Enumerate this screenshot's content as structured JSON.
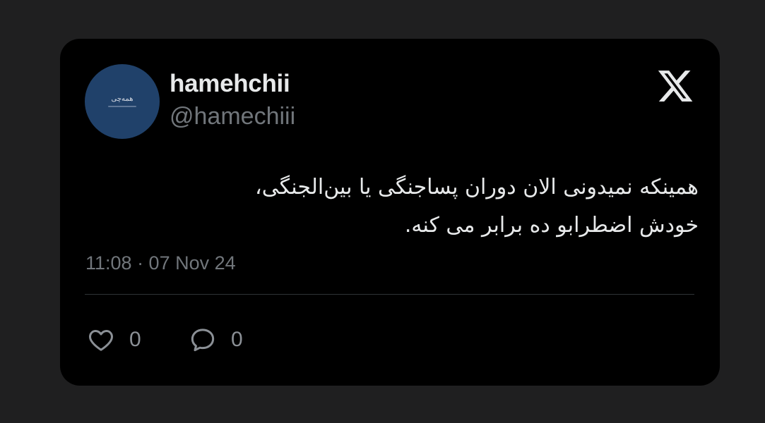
{
  "author": {
    "display_name": "hamehchii",
    "handle": "@hamechiii",
    "avatar_text": "همه‌چی"
  },
  "platform_icon": "x-logo-icon",
  "tweet": {
    "lines": [
      "همینکه نمیدونی الان دوران پساجنگی یا بین‌الجنگی،",
      "خودش اضطرابو ده برابر می کنه."
    ],
    "timestamp": "11:08 · 07 Nov 24"
  },
  "actions": {
    "like": {
      "icon": "heart-icon",
      "count": "0"
    },
    "reply": {
      "icon": "comment-icon",
      "count": "0"
    }
  },
  "colors": {
    "background": "#1f1f20",
    "card": "#000000",
    "text": "#e7e9ea",
    "muted": "#71767b",
    "avatar": "#20416a"
  }
}
